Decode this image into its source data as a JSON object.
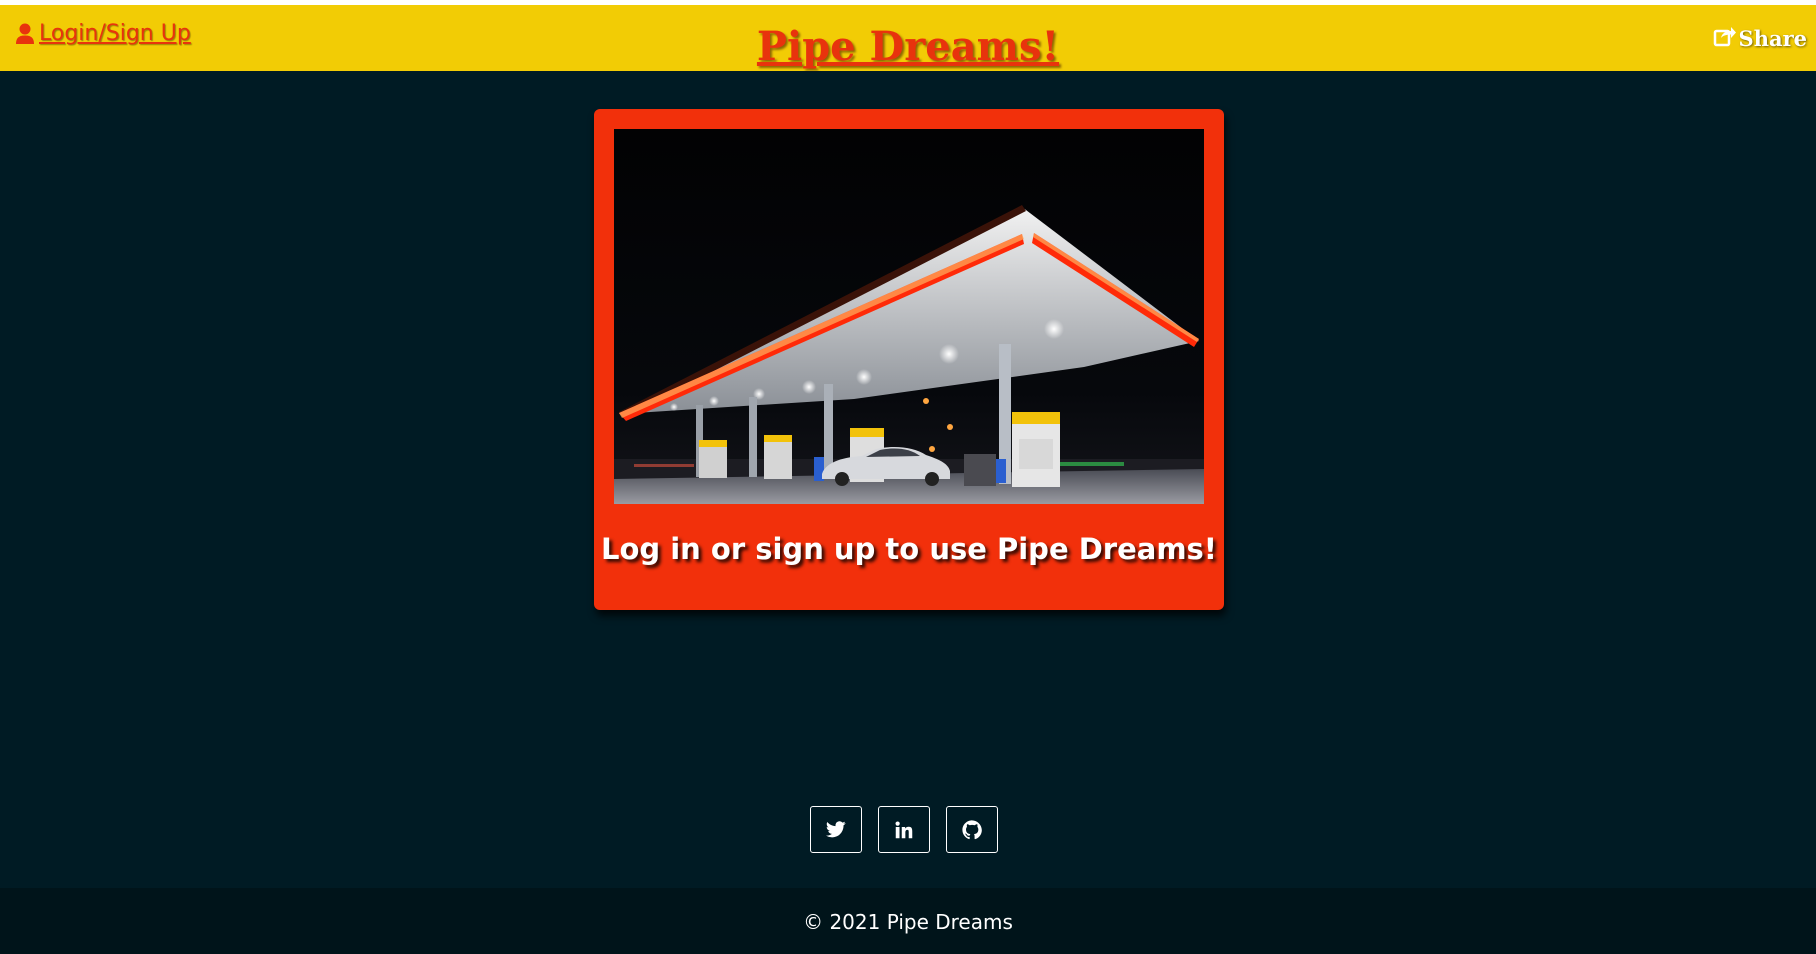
{
  "header": {
    "login_label": " Login/Sign Up",
    "title": "Pipe Dreams!",
    "share_label": "Share",
    "background_color": "#f2cc05",
    "accent_color": "#e8330d"
  },
  "card": {
    "image_alt": "Gas station at night",
    "caption": "Log in or sign up to use Pipe Dreams!",
    "background_color": "#f2300b"
  },
  "social": [
    {
      "name": "twitter",
      "icon": "twitter-icon"
    },
    {
      "name": "linkedin",
      "icon": "linkedin-icon"
    },
    {
      "name": "github",
      "icon": "github-icon"
    }
  ],
  "footer": {
    "text": "© 2021 Pipe Dreams"
  },
  "page": {
    "background_color": "#001b24"
  }
}
